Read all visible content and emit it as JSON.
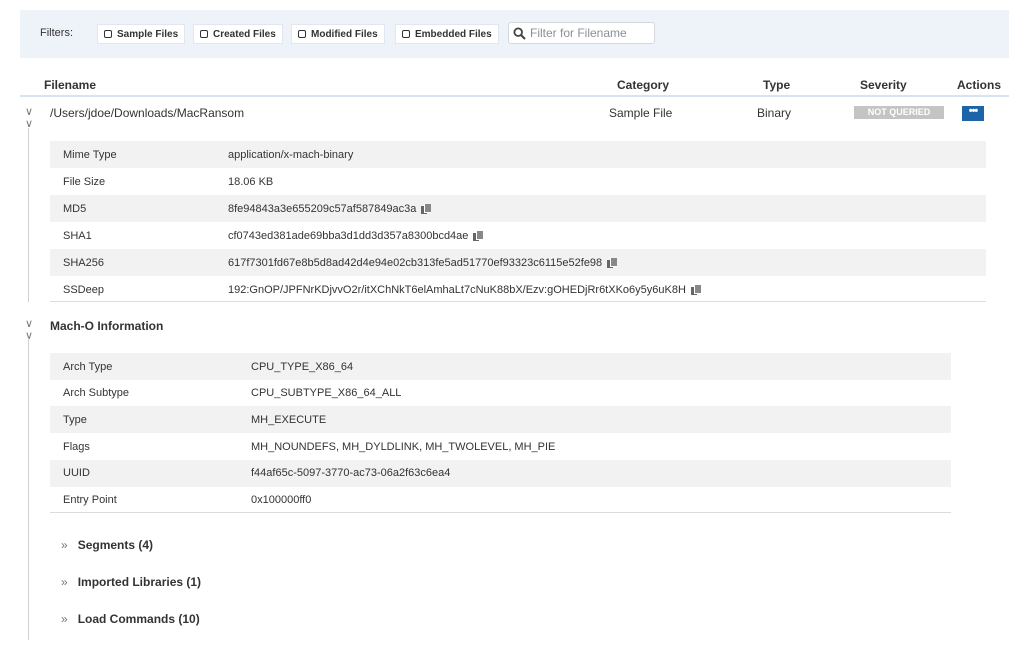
{
  "filters": {
    "label": "Filters:",
    "buttons": [
      {
        "label": "Sample Files"
      },
      {
        "label": "Created Files"
      },
      {
        "label": "Modified Files"
      },
      {
        "label": "Embedded Files"
      }
    ],
    "search_placeholder": "Filter for Filename"
  },
  "columns": {
    "filename": "Filename",
    "category": "Category",
    "type": "Type",
    "severity": "Severity",
    "actions": "Actions"
  },
  "file": {
    "path": "/Users/jdoe/Downloads/MacRansom",
    "category": "Sample File",
    "type": "Binary",
    "severity": "NOT QUERIED",
    "actions_label": "•••"
  },
  "file_details": [
    {
      "key": "Mime Type",
      "value": "application/x-mach-binary",
      "copy": false
    },
    {
      "key": "File Size",
      "value": "18.06 KB",
      "copy": false
    },
    {
      "key": "MD5",
      "value": "8fe94843a3e655209c57af587849ac3a",
      "copy": true
    },
    {
      "key": "SHA1",
      "value": "cf0743ed381ade69bba3d1dd3d357a8300bcd4ae",
      "copy": true
    },
    {
      "key": "SHA256",
      "value": "617f7301fd67e8b5d8ad42d4e94e02cb313fe5ad51770ef93323c6115e52fe98",
      "copy": true
    },
    {
      "key": "SSDeep",
      "value": "192:GnOP/JPFNrKDjvvO2r/itXChNkT6elAmhaLt7cNuK88bX/Ezv:gOHEDjRr6tXKo6y5y6uK8H",
      "copy": true
    }
  ],
  "macho": {
    "title": "Mach-O Information",
    "rows": [
      {
        "key": "Arch Type",
        "value": "CPU_TYPE_X86_64"
      },
      {
        "key": "Arch Subtype",
        "value": "CPU_SUBTYPE_X86_64_ALL"
      },
      {
        "key": "Type",
        "value": "MH_EXECUTE"
      },
      {
        "key": "Flags",
        "value": "MH_NOUNDEFS, MH_DYLDLINK, MH_TWOLEVEL, MH_PIE"
      },
      {
        "key": "UUID",
        "value": "f44af65c-5097-3770-ac73-06a2f63c6ea4"
      },
      {
        "key": "Entry Point",
        "value": "0x100000ff0"
      }
    ],
    "sections": [
      {
        "label": "Segments (4)"
      },
      {
        "label": "Imported Libraries (1)"
      },
      {
        "label": "Load Commands (10)"
      }
    ]
  },
  "icons": {
    "chevron": "double-chevron-down-icon",
    "expand": "double-chevron-right-icon",
    "copy": "copy-icon",
    "search": "search-icon"
  }
}
